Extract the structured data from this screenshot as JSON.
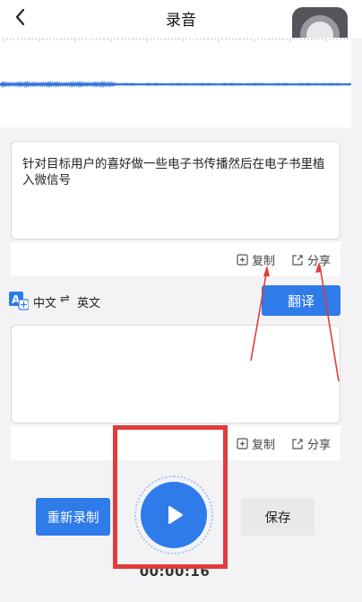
{
  "header": {
    "title": "录音"
  },
  "transcript": {
    "text": "针对目标用户的喜好做一些电子书传播然后在电子书里植入微信号"
  },
  "actions": {
    "copy_label": "复制",
    "share_label": "分享"
  },
  "language": {
    "source": "中文",
    "swap_symbol": "⇌",
    "target": "英文",
    "translate_label": "翻译"
  },
  "controls": {
    "rerecord_label": "重新录制",
    "save_label": "保存",
    "timer": "00:00:16"
  },
  "colors": {
    "accent": "#2f7bea",
    "annotation": "#e23b3b"
  }
}
